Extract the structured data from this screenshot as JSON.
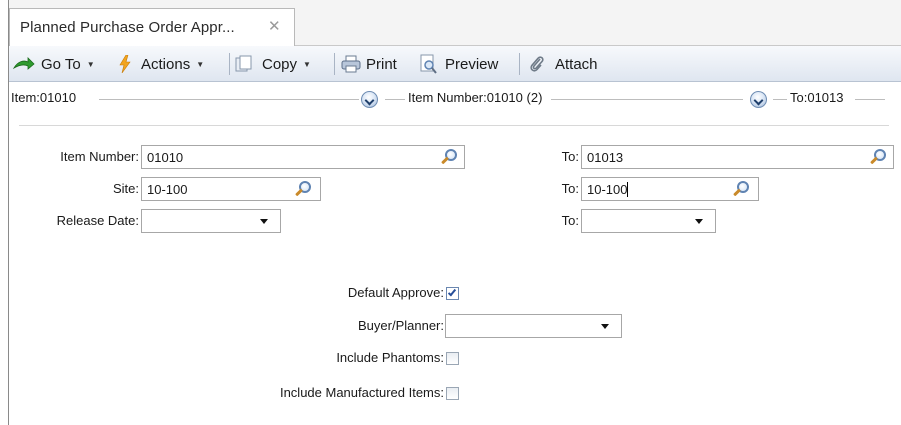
{
  "tab": {
    "title": "Planned Purchase Order Appr...",
    "close_glyph": "✕"
  },
  "toolbar": {
    "goto_label": "Go To",
    "actions_label": "Actions",
    "copy_label": "Copy",
    "print_label": "Print",
    "preview_label": "Preview",
    "attach_label": "Attach"
  },
  "nav": {
    "first": "Item:01010",
    "middle": "Item Number:01010 (2)",
    "last": "To:01013"
  },
  "form": {
    "item_number_label": "Item Number:",
    "item_number_value": "01010",
    "item_number_to_label": "To:",
    "item_number_to_value": "01013",
    "site_label": "Site:",
    "site_value": "10-100",
    "site_to_label": "To:",
    "site_to_value": "10-100",
    "release_date_label": "Release Date:",
    "release_date_value": "",
    "release_date_to_label": "To:",
    "release_date_to_value": "",
    "default_approve_label": "Default Approve:",
    "default_approve_checked": true,
    "buyer_planner_label": "Buyer/Planner:",
    "buyer_planner_value": "",
    "include_phantoms_label": "Include Phantoms:",
    "include_phantoms_checked": false,
    "include_manufactured_label": "Include Manufactured Items:",
    "include_manufactured_checked": false
  },
  "icons": {
    "goto": "green-arrow-icon",
    "actions": "lightning-icon",
    "copy": "copy-icon",
    "print": "printer-icon",
    "preview": "preview-icon",
    "attach": "paperclip-icon",
    "nav": "chevron-down-circle-icon",
    "lookup": "magnifier-icon"
  }
}
